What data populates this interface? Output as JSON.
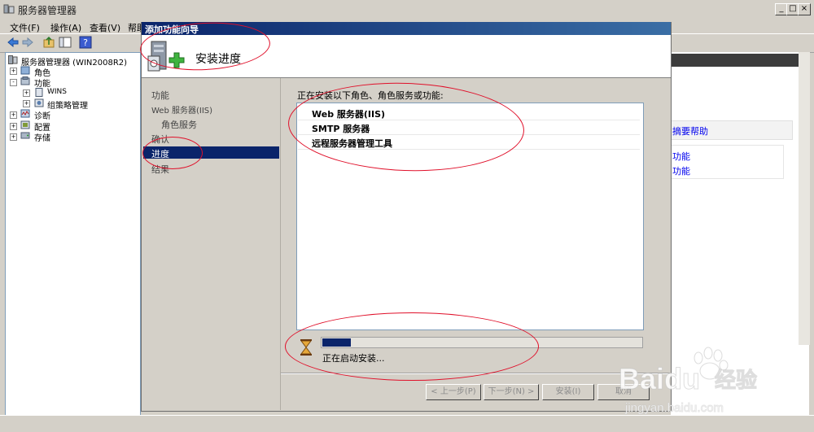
{
  "window": {
    "title": "服务器管理器",
    "controls": [
      "_",
      "□",
      "×"
    ]
  },
  "menubar": {
    "items": [
      "文件(F)",
      "操作(A)",
      "查看(V)",
      "帮助"
    ]
  },
  "tree": {
    "root": "服务器管理器 (WIN2008R2)",
    "items": [
      {
        "label": "角色",
        "expander": "+"
      },
      {
        "label": "功能",
        "expander": "-"
      },
      {
        "label": "WINS",
        "expander": "+"
      },
      {
        "label": "组策略管理",
        "expander": "+"
      },
      {
        "label": "诊断",
        "expander": "+"
      },
      {
        "label": "配置",
        "expander": "+"
      },
      {
        "label": "存储",
        "expander": "+"
      }
    ]
  },
  "right_pane": {
    "help_link": "摘要帮助",
    "links": [
      "功能",
      "功能"
    ]
  },
  "wizard": {
    "title": "添加功能向导",
    "heading": "安装进度",
    "nav": [
      "功能",
      "Web 服务器(IIS)",
      "角色服务",
      "确认",
      "进度",
      "结果"
    ],
    "selected_nav": "进度",
    "content_label": "正在安装以下角色、角色服务或功能:",
    "features": [
      "Web 服务器(IIS)",
      "SMTP 服务器",
      "远程服务器管理工具"
    ],
    "progress": 0.09,
    "status": "正在启动安装...",
    "buttons": {
      "prev": "< 上一步(P)",
      "next": "下一步(N) >",
      "install": "安装(I)",
      "cancel": "取消"
    }
  },
  "watermark": {
    "brand": "Baidu",
    "subtitle": "经验",
    "url": "jingyan.baidu.com"
  },
  "colors": {
    "selection": "#0a246a",
    "annotation": "#e0102a",
    "link": "#0000ee"
  }
}
